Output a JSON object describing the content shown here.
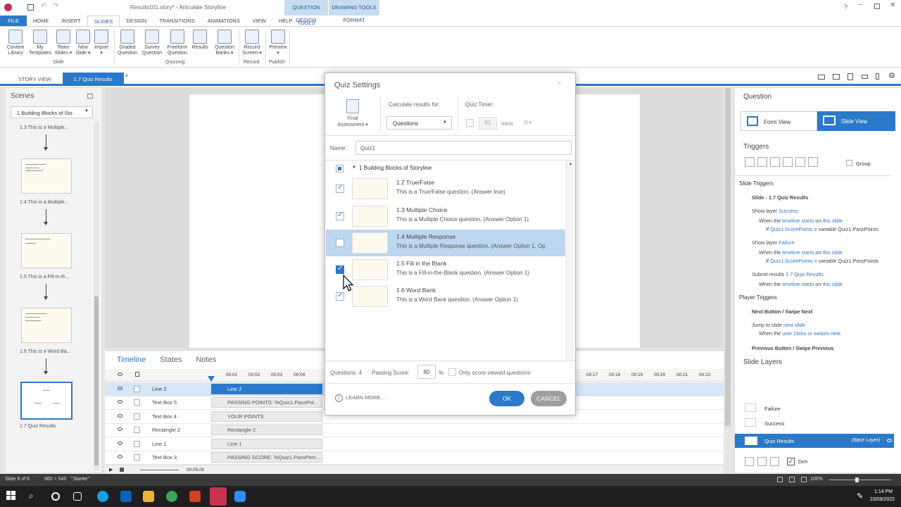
{
  "window": {
    "title": "Results101.story* - Articulate Storyline"
  },
  "context_tabs": [
    {
      "label": "QUESTION TOOLS",
      "sub": "DESIGN"
    },
    {
      "label": "DRAWING TOOLS",
      "sub": "FORMAT"
    }
  ],
  "ribbon_tabs": [
    "FILE",
    "HOME",
    "INSERT",
    "SLIDES",
    "DESIGN",
    "TRANSITIONS",
    "ANIMATIONS",
    "VIEW",
    "HELP"
  ],
  "ribbon": {
    "buttons": [
      {
        "l1": "Content",
        "l2": "Library"
      },
      {
        "l1": "My",
        "l2": "Templates"
      },
      {
        "l1": "Team",
        "l2": "Slides ▾"
      },
      {
        "l1": "New",
        "l2": "Slide ▾"
      },
      {
        "l1": "Import",
        "l2": "▾"
      },
      {
        "l1": "Graded",
        "l2": "Question"
      },
      {
        "l1": "Survey",
        "l2": "Question"
      },
      {
        "l1": "Freeform",
        "l2": "Question"
      },
      {
        "l1": "Results",
        "l2": ""
      },
      {
        "l1": "Question",
        "l2": "Banks ▾"
      },
      {
        "l1": "Record",
        "l2": "Screen ▾"
      },
      {
        "l1": "Preview",
        "l2": "▾"
      }
    ],
    "groups": [
      "Slide",
      "Quizzing",
      "Record",
      "Publish"
    ]
  },
  "view_tabs": [
    "STORY VIEW",
    "1.7 Quiz Results"
  ],
  "scenes": {
    "title": "Scenes",
    "dropdown": "1 Building Blocks of Sto",
    "items": [
      "1.3 This is a Multiple...",
      "1.4 This is a Multiple...",
      "1.5 This is a Fill-in-th...",
      "1.6 This is a Word Ba...",
      "1.7 Quiz Results"
    ]
  },
  "timeline": {
    "tabs": [
      "Timeline",
      "States",
      "Notes"
    ],
    "ticks": [
      "00:01",
      "00:02",
      "00:03",
      "00:04",
      "00:17",
      "00:18",
      "00:19",
      "00:20",
      "00:21",
      "00:22"
    ],
    "rows": [
      {
        "name": "Line 2",
        "bar": "Line 2"
      },
      {
        "name": "Text Box 5",
        "bar": "PASSING POINTS: %Quiz1.PassPoi..."
      },
      {
        "name": "Text Box 4",
        "bar": "YOUR POINTS"
      },
      {
        "name": "Rectangle 2",
        "bar": "Rectangle 2"
      },
      {
        "name": "Line 1",
        "bar": "Line 1"
      },
      {
        "name": "Text Box 3",
        "bar": "PASSING SCORE: %Quiz1.PassPerc..."
      }
    ],
    "end_time": "00:05.00"
  },
  "modal": {
    "title": "Quiz Settings",
    "final_assessment": {
      "l1": "Final",
      "l2": "Assessment ▾"
    },
    "calc_label": "Calculate results for:",
    "calc_value": "Questions",
    "timer_label": "Quiz Timer:",
    "timer_value": "60",
    "timer_unit": "mins",
    "name_label": "Name:",
    "name_value": "Quiz1",
    "scene": "1 Building Blocks of Storyline",
    "questions": [
      {
        "title": "1.2 True/False",
        "desc": "This is a True/False question. (Answer true)",
        "checked": true
      },
      {
        "title": "1.3 Multiple Choice",
        "desc": "This is a Multiple Choice question. (Answer Option 1)",
        "checked": true
      },
      {
        "title": "1.4 Multiple Response",
        "desc": "This is a Multiple Response question. (Answer Option 1. Op",
        "checked": false
      },
      {
        "title": "1.5 Fill in the Blank",
        "desc": "This is a Fill-in-the-Blank question. (Answer Option 1)",
        "checked": true
      },
      {
        "title": "1.6 Word Bank",
        "desc": "This is a Word Bank question. (Answer Option 1)",
        "checked": true
      }
    ],
    "questions_count": "Questions: 4",
    "passing_label": "Passing Score:",
    "passing_value": "80",
    "percent": "%",
    "only_viewed": "Only score viewed questions",
    "learn_more": "LEARN MORE...",
    "ok": "OK",
    "cancel": "CANCEL"
  },
  "right_panel": {
    "question": "Question",
    "form_view": "Form View",
    "slide_view": "Slide View",
    "triggers": "Triggers",
    "group": "Group",
    "slide_triggers": "Slide Triggers",
    "slide_name": "Slide - 1.7 Quiz Results",
    "player_triggers": "Player Triggers",
    "next_btn": "Next Button / Swipe Next",
    "prev_btn": "Previous Button / Swipe Previous",
    "slide_layers": "Slide Layers",
    "layers": [
      "Failure",
      "Success"
    ],
    "base_layer": "Quiz Results",
    "base_tag": "(Base Layer)",
    "dim": "Dim"
  },
  "status": {
    "slide": "Slide 6 of 6",
    "size": "960 × 540",
    "theme": "\"Starter\"",
    "zoom": "100%"
  },
  "clock": {
    "time": "1:14 PM",
    "date": "23/09/2022"
  },
  "colors": {
    "accent": "#2b79c9",
    "selected_row": "#bcd7ef",
    "ok_button": "#2b79c9",
    "cancel_button": "#9e9e9e"
  }
}
